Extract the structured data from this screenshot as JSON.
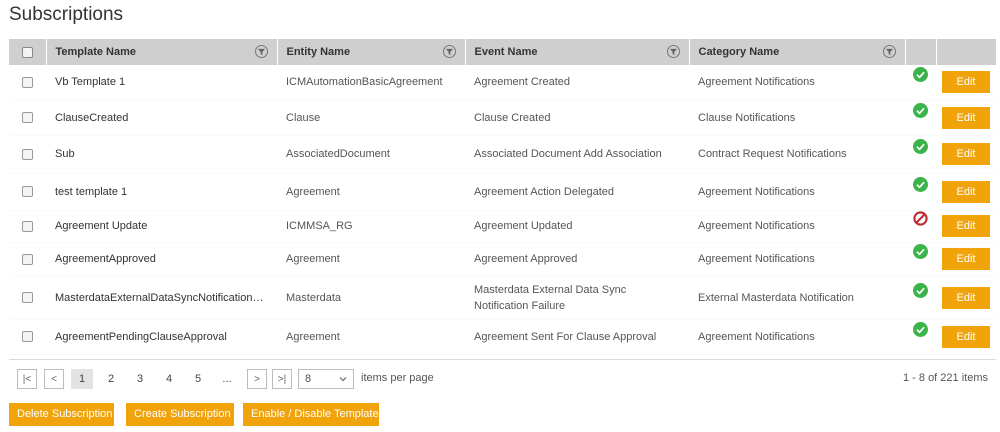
{
  "page": {
    "title": "Subscriptions"
  },
  "table": {
    "headers": {
      "template": "Template Name",
      "entity": "Entity Name",
      "event": "Event Name",
      "category": "Category Name"
    },
    "edit_label": "Edit",
    "rows": [
      {
        "template": "Vb Template 1",
        "entity": "ICMAutomationBasicAgreement",
        "event": "Agreement Created",
        "category": "Agreement Notifications",
        "status": "enabled"
      },
      {
        "template": "ClauseCreated",
        "entity": "Clause",
        "event": "Clause Created",
        "category": "Clause Notifications",
        "status": "enabled"
      },
      {
        "template": "Sub",
        "entity": "AssociatedDocument",
        "event": "Associated Document Add Association",
        "category": "Contract Request Notifications",
        "status": "enabled"
      },
      {
        "template": "test template 1",
        "entity": "Agreement",
        "event": "Agreement Action Delegated",
        "category": "Agreement Notifications",
        "status": "enabled"
      },
      {
        "template": "Agreement Update",
        "entity": "ICMMSA_RG",
        "event": "Agreement Updated",
        "category": "Agreement Notifications",
        "status": "disabled"
      },
      {
        "template": "AgreementApproved",
        "entity": "Agreement",
        "event": "Agreement Approved",
        "category": "Agreement Notifications",
        "status": "enabled"
      },
      {
        "template": "MasterdataExternalDataSyncNotificationFai...",
        "entity": "Masterdata",
        "event": "Masterdata External Data Sync Notification Failure",
        "category": "External Masterdata Notification",
        "status": "enabled"
      },
      {
        "template": "AgreementPendingClauseApproval",
        "entity": "Agreement",
        "event": "Agreement Sent For Clause Approval",
        "category": "Agreement Notifications",
        "status": "enabled"
      }
    ]
  },
  "pager": {
    "first": "|<",
    "prev": "<",
    "pages": [
      "1",
      "2",
      "3",
      "4",
      "5",
      "..."
    ],
    "active_page": "1",
    "next": ">",
    "last": ">|",
    "page_size": "8",
    "page_size_label": "items per page",
    "info": "1 - 8 of 221 items"
  },
  "actions": {
    "delete": "Delete Subscription",
    "create": "Create Subscription",
    "toggle": "Enable / Disable Template"
  },
  "colors": {
    "accent": "#f0a30a",
    "enabled": "#3cb44b",
    "disabled": "#c0282d",
    "header_bg": "#cfcfcf"
  }
}
